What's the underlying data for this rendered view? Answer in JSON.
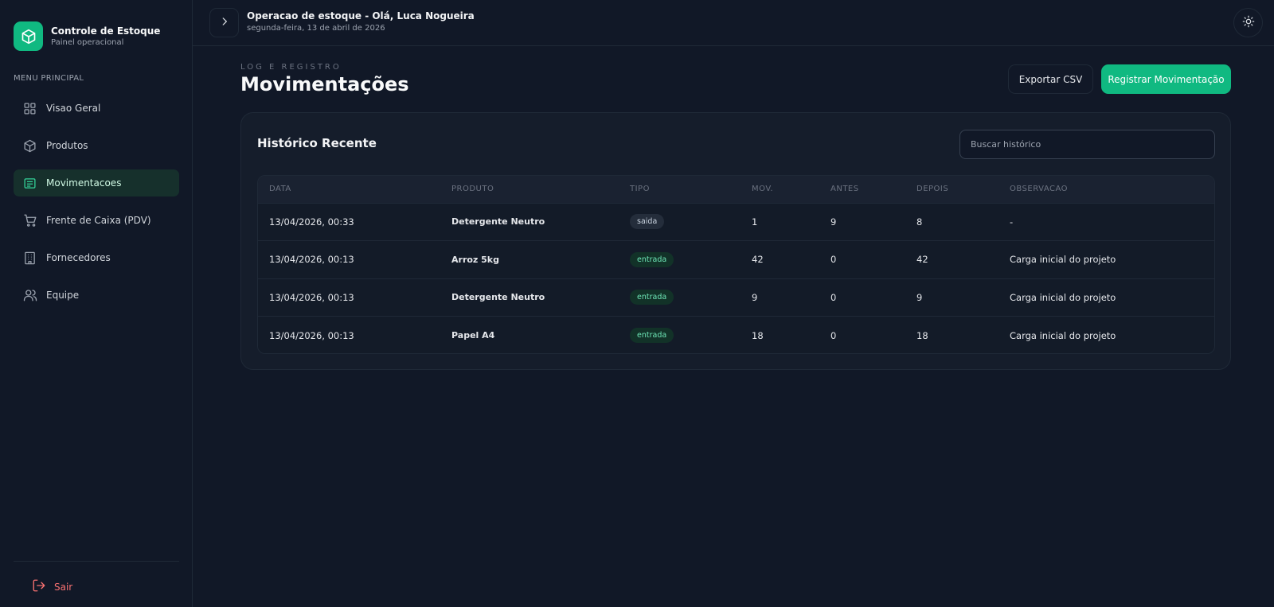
{
  "brand": {
    "title": "Controle de Estoque",
    "subtitle": "Painel operacional",
    "logo_icon": "box-icon",
    "accent": "#10b981"
  },
  "sidebar": {
    "heading": "MENU PRINCIPAL",
    "items": [
      {
        "label": "Visao Geral",
        "icon": "grid-icon",
        "active": false
      },
      {
        "label": "Produtos",
        "icon": "package-icon",
        "active": false
      },
      {
        "label": "Movimentacoes",
        "icon": "list-icon",
        "active": true
      },
      {
        "label": "Frente de Caixa (PDV)",
        "icon": "cart-icon",
        "active": false
      },
      {
        "label": "Fornecedores",
        "icon": "building-icon",
        "active": false
      },
      {
        "label": "Equipe",
        "icon": "users-icon",
        "active": false
      }
    ],
    "logout_label": "Sair"
  },
  "header": {
    "title": "Operacao de estoque - Olá, Luca Nogueira",
    "date": "segunda-feira, 13 de abril de 2026"
  },
  "page": {
    "eyebrow": "LOG E REGISTRO",
    "title": "Movimentações",
    "export_label": "Exportar CSV",
    "register_label": "Registrar Movimentação"
  },
  "history": {
    "title": "Histórico Recente",
    "search_placeholder": "Buscar histórico",
    "columns": [
      "DATA",
      "PRODUTO",
      "TIPO",
      "MOV.",
      "ANTES",
      "DEPOIS",
      "OBSERVACAO"
    ],
    "rows": [
      {
        "data": "13/04/2026, 00:33",
        "produto": "Detergente Neutro",
        "tipo": "saida",
        "mov": "1",
        "antes": "9",
        "depois": "8",
        "obs": "-"
      },
      {
        "data": "13/04/2026, 00:13",
        "produto": "Arroz 5kg",
        "tipo": "entrada",
        "mov": "42",
        "antes": "0",
        "depois": "42",
        "obs": "Carga inicial do projeto"
      },
      {
        "data": "13/04/2026, 00:13",
        "produto": "Detergente Neutro",
        "tipo": "entrada",
        "mov": "9",
        "antes": "0",
        "depois": "9",
        "obs": "Carga inicial do projeto"
      },
      {
        "data": "13/04/2026, 00:13",
        "produto": "Papel A4",
        "tipo": "entrada",
        "mov": "18",
        "antes": "0",
        "depois": "18",
        "obs": "Carga inicial do projeto"
      }
    ]
  }
}
